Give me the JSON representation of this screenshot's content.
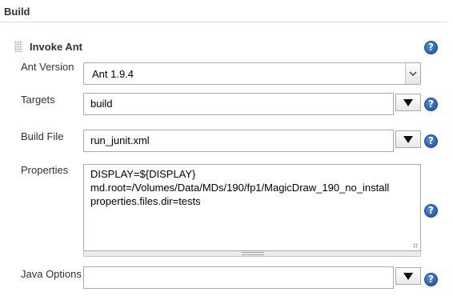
{
  "section": {
    "title": "Build"
  },
  "step": {
    "title": "Invoke Ant"
  },
  "help": {
    "glyph": "?"
  },
  "fields": {
    "ant_version": {
      "label": "Ant Version",
      "value": "Ant 1.9.4"
    },
    "targets": {
      "label": "Targets",
      "value": "build"
    },
    "build_file": {
      "label": "Build File",
      "value": "run_junit.xml"
    },
    "properties": {
      "label": "Properties",
      "lines": [
        "DISPLAY=${DISPLAY}",
        "md.root=/Volumes/Data/MDs/190/fp1/MagicDraw_190_no_install",
        "properties.files.dir=tests"
      ]
    },
    "java_options": {
      "label": "Java Options",
      "value": ""
    }
  },
  "colors": {
    "help_blue": "#2a5ea8",
    "rule": "#dddddd"
  },
  "icons": {
    "help": "help-icon",
    "expand": "expand-arrow-icon",
    "drag": "drag-handle-icon"
  }
}
